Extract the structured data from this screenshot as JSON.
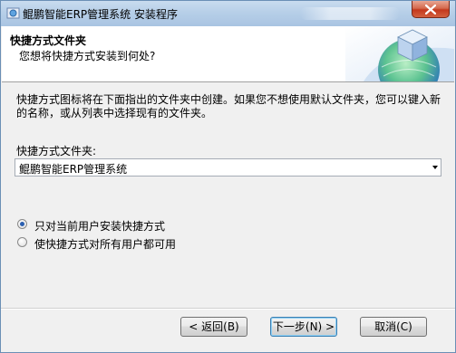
{
  "window": {
    "title": "鲲鹏智能ERP管理系统 安装程序"
  },
  "header": {
    "title": "快捷方式文件夹",
    "subtitle": "您想将快捷方式安装到何处?"
  },
  "body": {
    "description": "快捷方式图标将在下面指出的文件夹中创建。如果您不想使用默认文件夹，您可以键入新的名称，或从列表中选择现有的文件夹。",
    "folder_label": "快捷方式文件夹:",
    "folder_value": "鲲鹏智能ERP管理系统"
  },
  "options": [
    {
      "label": "只对当前用户安装快捷方式",
      "checked": true
    },
    {
      "label": "使快捷方式对所有用户都可用",
      "checked": false
    }
  ],
  "buttons": {
    "back": "< 返回(B)",
    "next": "下一步(N) >",
    "cancel": "取消(C)"
  },
  "icons": {
    "title": "installer-icon",
    "close": "close-icon",
    "header": "globe-cube-graphic"
  }
}
